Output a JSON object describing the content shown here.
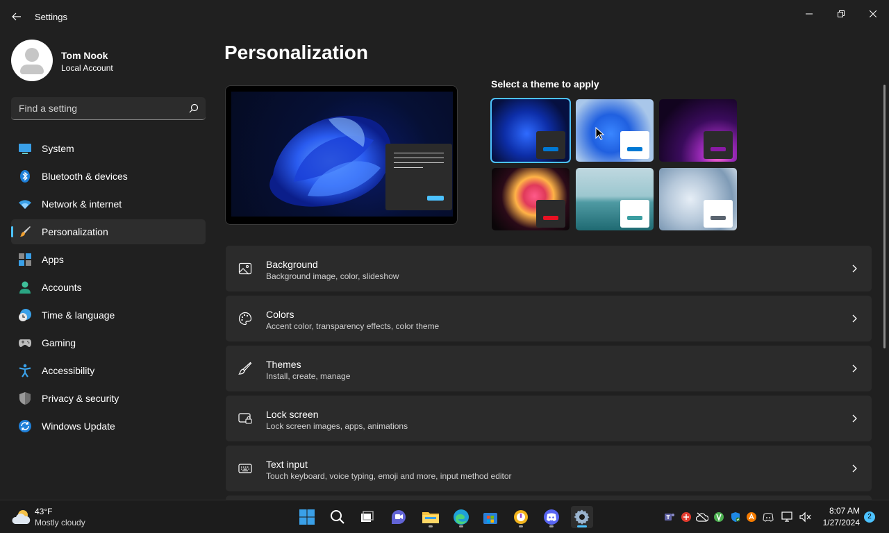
{
  "window": {
    "title": "Settings",
    "minimize_icon": "minimize-icon",
    "maximize_icon": "restore-icon",
    "close_icon": "close-icon"
  },
  "profile": {
    "name": "Tom Nook",
    "account_type": "Local Account"
  },
  "search": {
    "placeholder": "Find a setting"
  },
  "sidebar": {
    "items": [
      {
        "label": "System",
        "icon": "monitor-icon"
      },
      {
        "label": "Bluetooth & devices",
        "icon": "bluetooth-icon"
      },
      {
        "label": "Network & internet",
        "icon": "wifi-icon"
      },
      {
        "label": "Personalization",
        "icon": "brush-icon",
        "active": true
      },
      {
        "label": "Apps",
        "icon": "apps-icon"
      },
      {
        "label": "Accounts",
        "icon": "person-icon"
      },
      {
        "label": "Time & language",
        "icon": "clock-globe-icon"
      },
      {
        "label": "Gaming",
        "icon": "gamepad-icon"
      },
      {
        "label": "Accessibility",
        "icon": "accessibility-icon"
      },
      {
        "label": "Privacy & security",
        "icon": "shield-icon"
      },
      {
        "label": "Windows Update",
        "icon": "update-icon"
      }
    ]
  },
  "main": {
    "title": "Personalization",
    "themes_label": "Select a theme to apply",
    "themes": [
      {
        "id": "windows-dark",
        "selected": true,
        "accent": "#0078d4"
      },
      {
        "id": "windows-light",
        "selected": false,
        "accent": "#0078d4"
      },
      {
        "id": "glow",
        "selected": false,
        "accent": "#8a1aa6"
      },
      {
        "id": "captured-motion",
        "selected": false,
        "accent": "#e81123"
      },
      {
        "id": "sunrise",
        "selected": false,
        "accent": "#3a9da0"
      },
      {
        "id": "flow",
        "selected": false,
        "accent": "#5a6470"
      }
    ],
    "cards": [
      {
        "title": "Background",
        "subtitle": "Background image, color, slideshow",
        "icon": "image-icon"
      },
      {
        "title": "Colors",
        "subtitle": "Accent color, transparency effects, color theme",
        "icon": "palette-icon"
      },
      {
        "title": "Themes",
        "subtitle": "Install, create, manage",
        "icon": "brush-icon"
      },
      {
        "title": "Lock screen",
        "subtitle": "Lock screen images, apps, animations",
        "icon": "lock-screen-icon"
      },
      {
        "title": "Text input",
        "subtitle": "Touch keyboard, voice typing, emoji and more, input method editor",
        "icon": "keyboard-icon"
      }
    ]
  },
  "taskbar": {
    "weather": {
      "temp": "43°F",
      "desc": "Mostly cloudy"
    },
    "clock": {
      "time": "8:07 AM",
      "date": "1/27/2024"
    },
    "notification_count": "2"
  },
  "colors": {
    "accent": "#4cc2ff",
    "background": "#202020",
    "card": "#2b2b2b"
  }
}
